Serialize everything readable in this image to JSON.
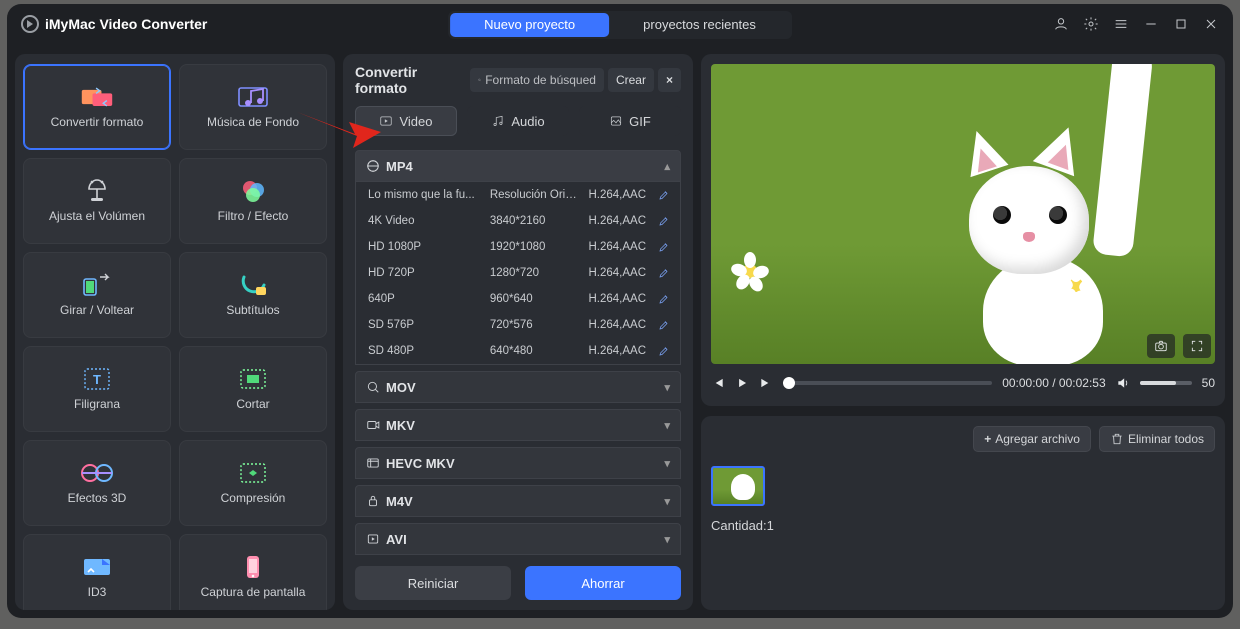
{
  "app": {
    "title": "iMyMac Video Converter"
  },
  "header": {
    "new_project": "Nuevo proyecto",
    "recent_projects": "proyectos recientes"
  },
  "sidebar": {
    "items": [
      {
        "label": "Convertir formato",
        "icon": "convert-format-icon",
        "active": true
      },
      {
        "label": "Música de Fondo",
        "icon": "background-music-icon"
      },
      {
        "label": "Ajusta el Volúmen",
        "icon": "adjust-volume-icon"
      },
      {
        "label": "Filtro / Efecto",
        "icon": "filter-effect-icon"
      },
      {
        "label": "Girar / Voltear",
        "icon": "rotate-flip-icon"
      },
      {
        "label": "Subtítulos",
        "icon": "subtitles-icon"
      },
      {
        "label": "Filigrana",
        "icon": "watermark-icon"
      },
      {
        "label": "Cortar",
        "icon": "cut-icon"
      },
      {
        "label": "Efectos 3D",
        "icon": "effects-3d-icon"
      },
      {
        "label": "Compresión",
        "icon": "compression-icon"
      },
      {
        "label": "ID3",
        "icon": "id3-icon"
      },
      {
        "label": "Captura de pantalla",
        "icon": "screenshot-icon"
      }
    ]
  },
  "format_panel": {
    "title": "Convertir formato",
    "search_placeholder": "Formato de búsqued",
    "create_btn": "Crear",
    "close_btn": "×",
    "tabs": {
      "video": "Video",
      "audio": "Audio",
      "gif": "GIF"
    },
    "active_tab": "video",
    "groups": [
      {
        "name": "MP4",
        "open": true,
        "rows": [
          {
            "label": "Lo mismo que la fu...",
            "res": "Resolución Original",
            "codec": "H.264,AAC"
          },
          {
            "label": "4K Video",
            "res": "3840*2160",
            "codec": "H.264,AAC"
          },
          {
            "label": "HD 1080P",
            "res": "1920*1080",
            "codec": "H.264,AAC"
          },
          {
            "label": "HD 720P",
            "res": "1280*720",
            "codec": "H.264,AAC"
          },
          {
            "label": "640P",
            "res": "960*640",
            "codec": "H.264,AAC"
          },
          {
            "label": "SD 576P",
            "res": "720*576",
            "codec": "H.264,AAC"
          },
          {
            "label": "SD 480P",
            "res": "640*480",
            "codec": "H.264,AAC"
          }
        ]
      },
      {
        "name": "MOV",
        "open": false
      },
      {
        "name": "MKV",
        "open": false
      },
      {
        "name": "HEVC MKV",
        "open": false
      },
      {
        "name": "M4V",
        "open": false
      },
      {
        "name": "AVI",
        "open": false
      }
    ],
    "reset_btn": "Reiniciar",
    "save_btn": "Ahorrar"
  },
  "preview": {
    "time_current": "00:00:00",
    "time_total": "00:02:53",
    "volume_value": "50"
  },
  "file_panel": {
    "add_file": "Agregar archivo",
    "remove_all": "Eliminar todos",
    "quantity_label": "Cantidad:",
    "quantity_value": "1"
  }
}
